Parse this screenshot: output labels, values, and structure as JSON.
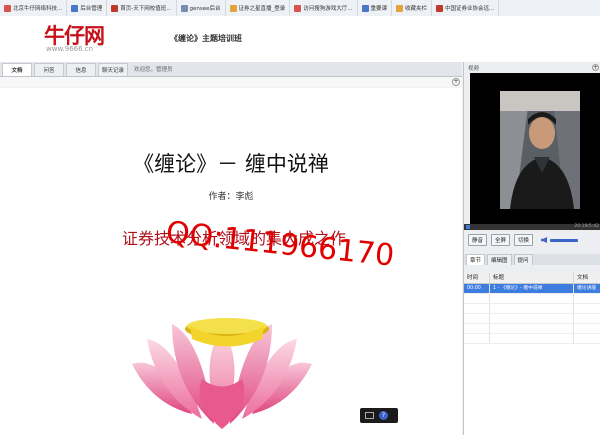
{
  "bookmarks": [
    {
      "label": "北京牛仔网络科技...",
      "color": "#d9534f"
    },
    {
      "label": "后台管理",
      "color": "#4a76c9"
    },
    {
      "label": "首页-天下网校值班...",
      "color": "#c0392b"
    },
    {
      "label": "gensee后台",
      "color": "#7a8bb0"
    },
    {
      "label": "证券之星直播_登录",
      "color": "#e2a33a"
    },
    {
      "label": "访问搜狗游戏大厅...",
      "color": "#d9534f"
    },
    {
      "label": "重要课",
      "color": "#4a76c9"
    },
    {
      "label": "收藏夹栏",
      "color": "#e2a33a"
    },
    {
      "label": "中国证券业协会远...",
      "color": "#c0392b"
    }
  ],
  "header": {
    "logo": "牛仔网",
    "logo_url": "www.9666.cn",
    "title": "《缠论》主题培训班"
  },
  "tabs": [
    "文档",
    "问答",
    "信息",
    "聊天记录"
  ],
  "welcome": "欢迎您，管理员",
  "document": {
    "title": "《缠论》－ 缠中说禅",
    "author": "作者：李彪",
    "subtitle": "证券技术分析领域的集大成之作",
    "watermark": "QQ:111966170"
  },
  "side": {
    "video_label": "视频",
    "video_time": "20:19/5:42",
    "buttons": [
      "静音",
      "全屏",
      "切换"
    ],
    "tabs": [
      "章节",
      "编辑图",
      "提问"
    ],
    "table": {
      "headers": [
        "时间",
        "标题",
        "文档"
      ],
      "rows": [
        [
          "00:00",
          "1 - 《缠论》- 缠中说禅",
          "缠论讲座"
        ]
      ]
    }
  },
  "colors": {
    "brand": "#c8101b",
    "selection": "#3d7de0"
  }
}
